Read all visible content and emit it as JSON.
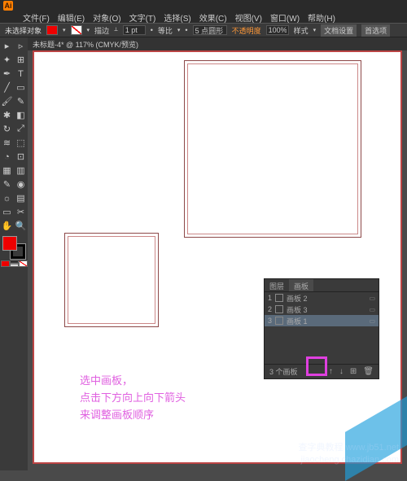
{
  "app": {
    "logo": "Ai"
  },
  "menu": [
    "文件(F)",
    "编辑(E)",
    "对象(O)",
    "文字(T)",
    "选择(S)",
    "效果(C)",
    "视图(V)",
    "窗口(W)",
    "帮助(H)"
  ],
  "options": {
    "selection": "未选择对象",
    "fill_label": "",
    "stroke_label": "描边",
    "stroke_weight": "1 pt",
    "uniform": "等比",
    "shape_input": "5 点圆形",
    "opacity_label": "不透明度",
    "opacity_value": "100%",
    "style_label": "样式",
    "doc_setup": "文档设置",
    "prefs": "首选项"
  },
  "doc_tab": "未标题-4* @ 117% (CMYK/预览)",
  "panel": {
    "tabs": [
      "图层",
      "画板"
    ],
    "active_tab": 1,
    "items": [
      {
        "index": "1",
        "name": "画板 2"
      },
      {
        "index": "2",
        "name": "画板 3"
      },
      {
        "index": "3",
        "name": "画板 1"
      }
    ],
    "selected": 2,
    "footer": "3 个画板",
    "icons": {
      "up": "↑",
      "down": "↓",
      "new": "⊞",
      "del": "🗑"
    }
  },
  "annotation": {
    "line1": "选中画板，",
    "line2": "点击下方向上向下箭头",
    "line3": "来调整画板顺序"
  },
  "watermark": {
    "l1": "查字典教程 www.jb51.net",
    "l2": "jiaocheng.chazidian.com"
  },
  "tools": {
    "row": [
      "▸",
      "▹",
      "✦",
      "⊞",
      "T",
      "╱",
      "▭",
      "🖌",
      "✎",
      "↻",
      "☼",
      "⊡",
      "✥",
      "⬚",
      "✂",
      "▤",
      "🔍",
      "✋",
      "⟋"
    ]
  }
}
